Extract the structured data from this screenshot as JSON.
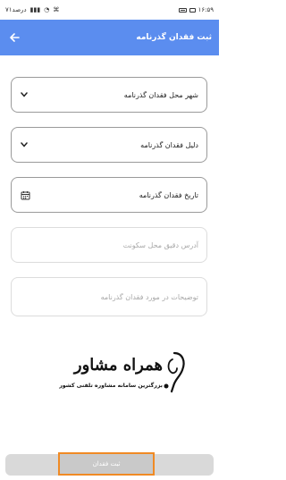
{
  "status_bar": {
    "time": "۱۶:۵۹",
    "battery": "۷۱درصد"
  },
  "header": {
    "title": "ثبت فقدان گذرنامه"
  },
  "form": {
    "city": {
      "label": "شهر محل فقدان گذرنامه"
    },
    "reason": {
      "label": "دلیل فقدان گذرنامه"
    },
    "date": {
      "label": "تاریخ فقدان گذرنامه"
    },
    "address": {
      "placeholder": "آدرس دقیق محل سکونت"
    },
    "description": {
      "placeholder": "توضیحات در مورد فقدان گذرنامه"
    }
  },
  "watermark": {
    "title": "همراه مشاور",
    "subtitle": "بزرگترین سامانه مشاوره تلفنی کشور"
  },
  "submit": {
    "label": "ثبت فقدان"
  },
  "colors": {
    "app_bar": "#5b8def",
    "highlight": "#f08a24"
  }
}
